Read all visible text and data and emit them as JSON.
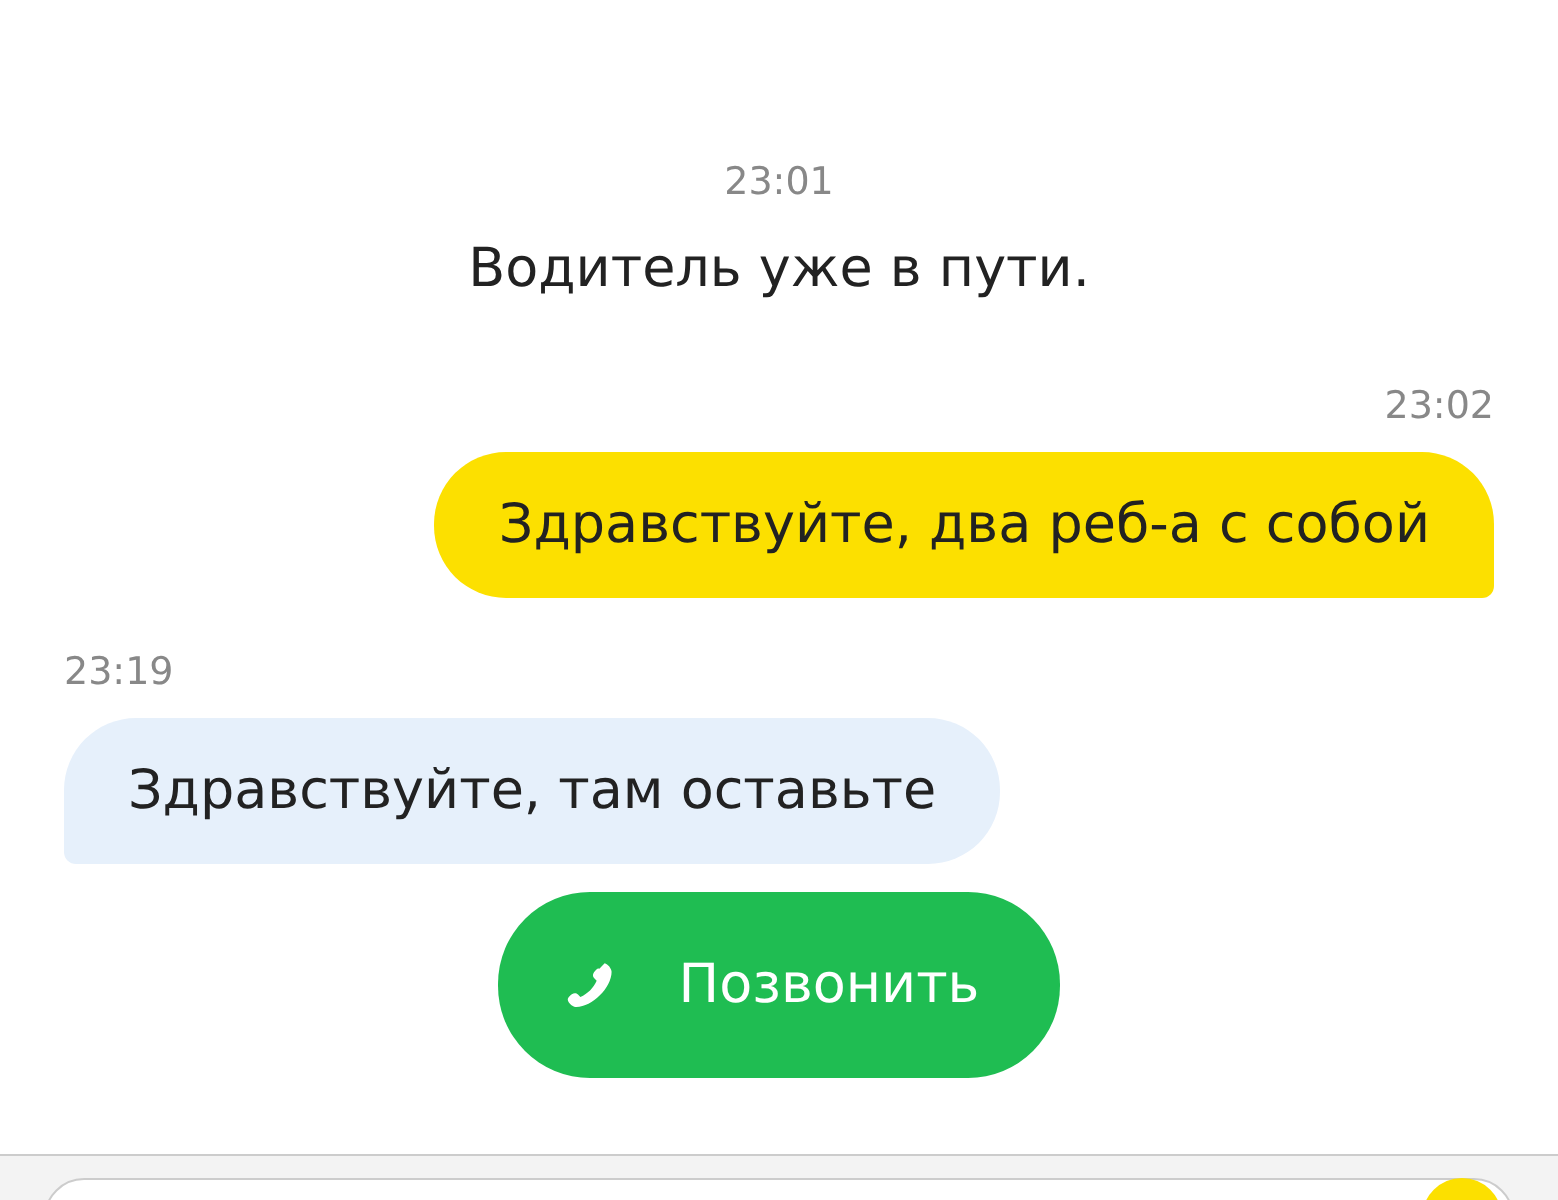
{
  "messages": [
    {
      "kind": "system",
      "time": "23:01",
      "text": "Водитель уже в пути."
    },
    {
      "kind": "outgoing",
      "time": "23:02",
      "text": "Здравствуйте, два реб-а с собой"
    },
    {
      "kind": "incoming",
      "time": "23:19",
      "text": "Здравствуйте, там оставьте"
    }
  ],
  "call_button": {
    "label": "Позвонить"
  }
}
